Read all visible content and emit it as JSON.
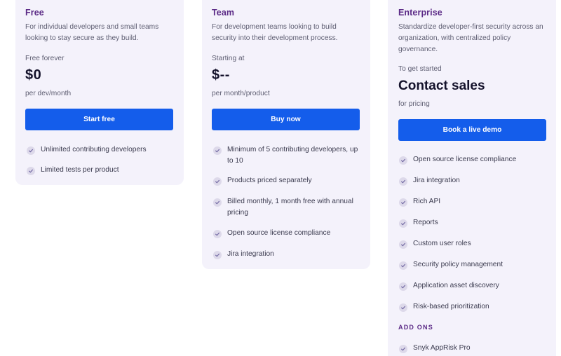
{
  "free": {
    "name": "Free",
    "description": "For individual developers and small teams looking to stay secure as they build.",
    "price_caption": "Free forever",
    "price": "$0",
    "price_unit": "per dev/month",
    "button": "Start free",
    "features": [
      "Unlimited contributing developers",
      "Limited tests per product"
    ]
  },
  "team": {
    "name": "Team",
    "description": "For development teams looking to build security into their development process.",
    "price_caption": "Starting at",
    "price": "$--",
    "price_unit": "per month/product",
    "button": "Buy now",
    "features": [
      "Minimum of 5 contributing developers, up to 10",
      "Products priced separately",
      "Billed monthly, 1 month free with annual pricing",
      "Open source license compliance",
      "Jira integration"
    ]
  },
  "enterprise": {
    "name": "Enterprise",
    "description": "Standardize developer-first security across an organization, with centralized policy governance.",
    "price_caption": "To get started",
    "price": "Contact sales",
    "price_unit": "for pricing",
    "button": "Book a live demo",
    "features": [
      "Open source license compliance",
      "Jira integration",
      "Rich API",
      "Reports",
      "Custom user roles",
      "Security policy management",
      "Application asset discovery",
      "Risk-based prioritization"
    ],
    "addons_label": "ADD ONS",
    "addons": [
      "Snyk AppRisk Pro"
    ]
  },
  "colors": {
    "card_bg": "#f4f2fb",
    "accent_button": "#145deb",
    "plan_name": "#5b2a86",
    "check_bg": "#ddd9ea"
  },
  "icons": {
    "feature_check": "check-icon"
  }
}
